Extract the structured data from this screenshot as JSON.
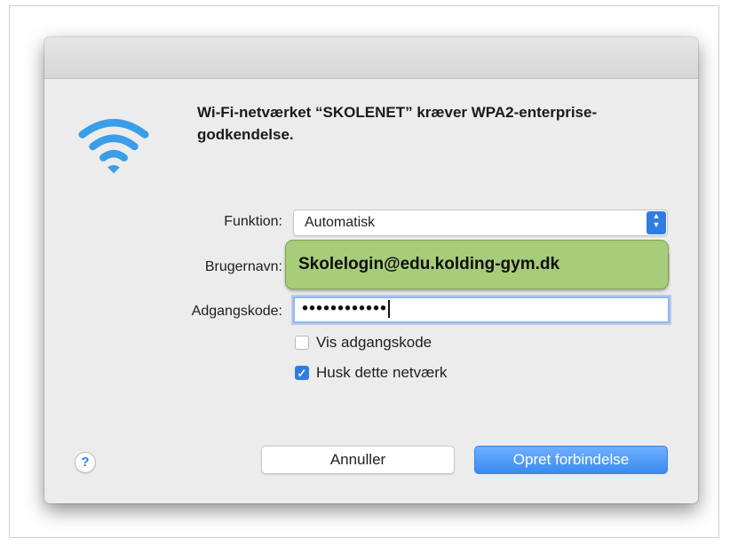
{
  "dialog": {
    "message": "Wi-Fi-netværket “SKOLENET” kræver WPA2-enterprise-godkendelse.",
    "icon": "wifi-icon"
  },
  "form": {
    "mode_label": "Funktion:",
    "mode_value": "Automatisk",
    "username_label": "Brugernavn:",
    "password_label": "Adgangskode:",
    "password_masked": "••••••••••••",
    "show_password_label": "Vis adgangskode",
    "show_password_checked": false,
    "remember_label": "Husk dette netværk",
    "remember_checked": true
  },
  "annotation": {
    "callout_text": "Skolelogin@edu.kolding-gym.dk"
  },
  "buttons": {
    "help": "?",
    "cancel": "Annuller",
    "connect": "Opret forbindelse"
  },
  "colors": {
    "accent": "#2f7de1",
    "callout": "#a7cc7a",
    "wifi": "#3a9ee8"
  }
}
